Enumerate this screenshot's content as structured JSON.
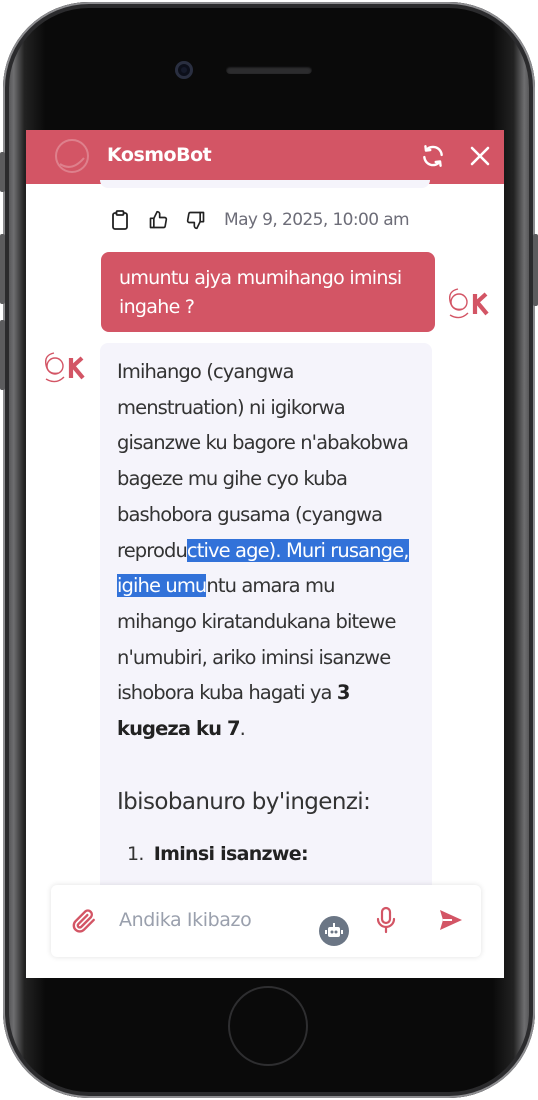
{
  "header": {
    "title": "KosmoBot",
    "refresh_icon": "refresh-icon",
    "close_icon": "close-icon",
    "bg_color": "#d35565"
  },
  "actions": {
    "copy_icon": "clipboard-icon",
    "like_icon": "thumbs-up-icon",
    "dislike_icon": "thumbs-down-icon",
    "timestamp": "May 9, 2025, 10:00 am"
  },
  "messages": {
    "user": {
      "line1": "umuntu ajya mumihango iminsi",
      "line2": "ingahe ?"
    },
    "bot": {
      "part1": "Imihango (cyangwa\nmenstruation) ni igikorwa\ngisanzwe ku bagore n'abakobwa\nbageze mu gihe cyo kuba\nbashobora gusama (cyangwa\nreprodu",
      "highlight1": "ctive age). Muri rusange,",
      "highlight2": "igihe umu",
      "part2": "ntu amara mu\nmihango kiratandukana bitewe\nn'umubiri, ariko iminsi isanzwe\nishobora kuba hagati ya ",
      "bold": "3\nkugeza ku 7",
      "end": ".",
      "heading": "Ibisobanuro by'ingenzi:",
      "list_number": "1.",
      "list_item": "Iminsi isanzwe:"
    }
  },
  "input": {
    "placeholder": "Andika Ikibazo",
    "attach_icon": "paperclip-icon",
    "bot_icon": "robot-icon",
    "mic_icon": "microphone-icon",
    "send_icon": "send-icon"
  },
  "colors": {
    "accent": "#d35565",
    "highlight": "#3272d9",
    "bubble_bg": "#f5f4fb"
  }
}
